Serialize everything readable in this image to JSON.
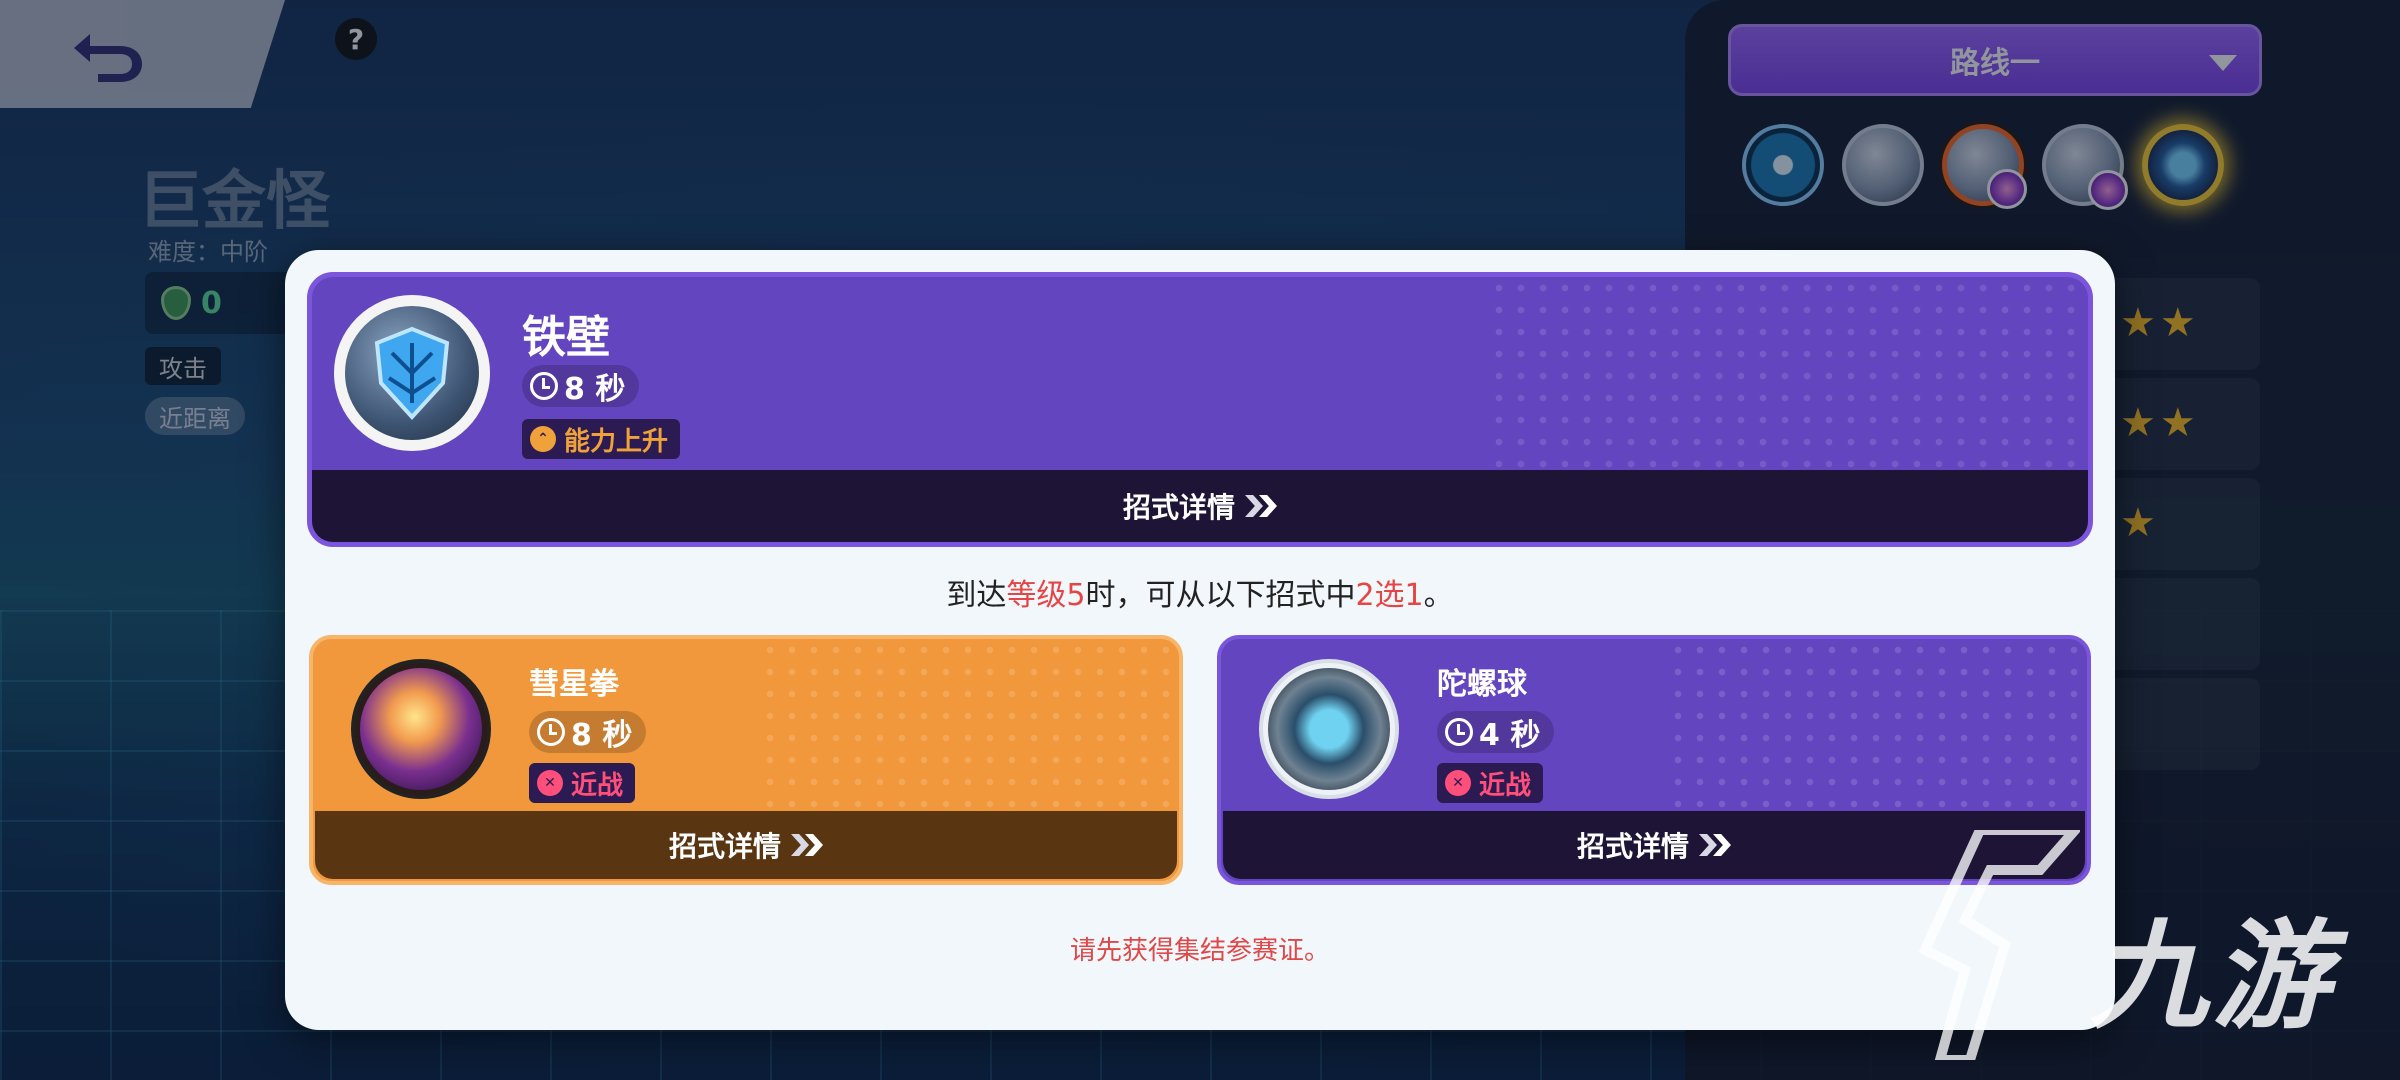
{
  "background": {
    "pokemon_name": "巨金怪",
    "difficulty": "难度：中阶",
    "stat_value": "0",
    "help_glyph": "?",
    "tags": [
      "攻击",
      "近距离"
    ],
    "accent_color": "#6445c0"
  },
  "right_panel": {
    "route_label": "路线一",
    "route_icons": [
      "bullet-punch-icon",
      "iron-defense-icon",
      "iron-wall-icon",
      "gyro-ball-icon",
      "unite-move-icon"
    ],
    "star_rows": [
      "★★",
      "★★",
      "★"
    ]
  },
  "modal": {
    "main_move": {
      "name": "铁壁",
      "cooldown": "8 秒",
      "type_label": "能力上升",
      "type_color": "#f0a23a",
      "detail_label": "招式详情"
    },
    "choose_text": {
      "part1": "到达",
      "highlight1": "等级5",
      "part2": "时，可从以下招式中",
      "highlight2": "2选1",
      "part3": "。"
    },
    "options": [
      {
        "name": "彗星拳",
        "cooldown": "8 秒",
        "type_label": "近战",
        "type_color": "#ff4f7a",
        "detail_label": "招式详情",
        "card_color": "#f1983c"
      },
      {
        "name": "陀螺球",
        "cooldown": "4 秒",
        "type_label": "近战",
        "type_color": "#ff4f7a",
        "detail_label": "招式详情",
        "card_color": "#6445c0"
      }
    ],
    "warning": "请先获得集结参赛证。"
  },
  "watermark": {
    "text": "九游"
  }
}
